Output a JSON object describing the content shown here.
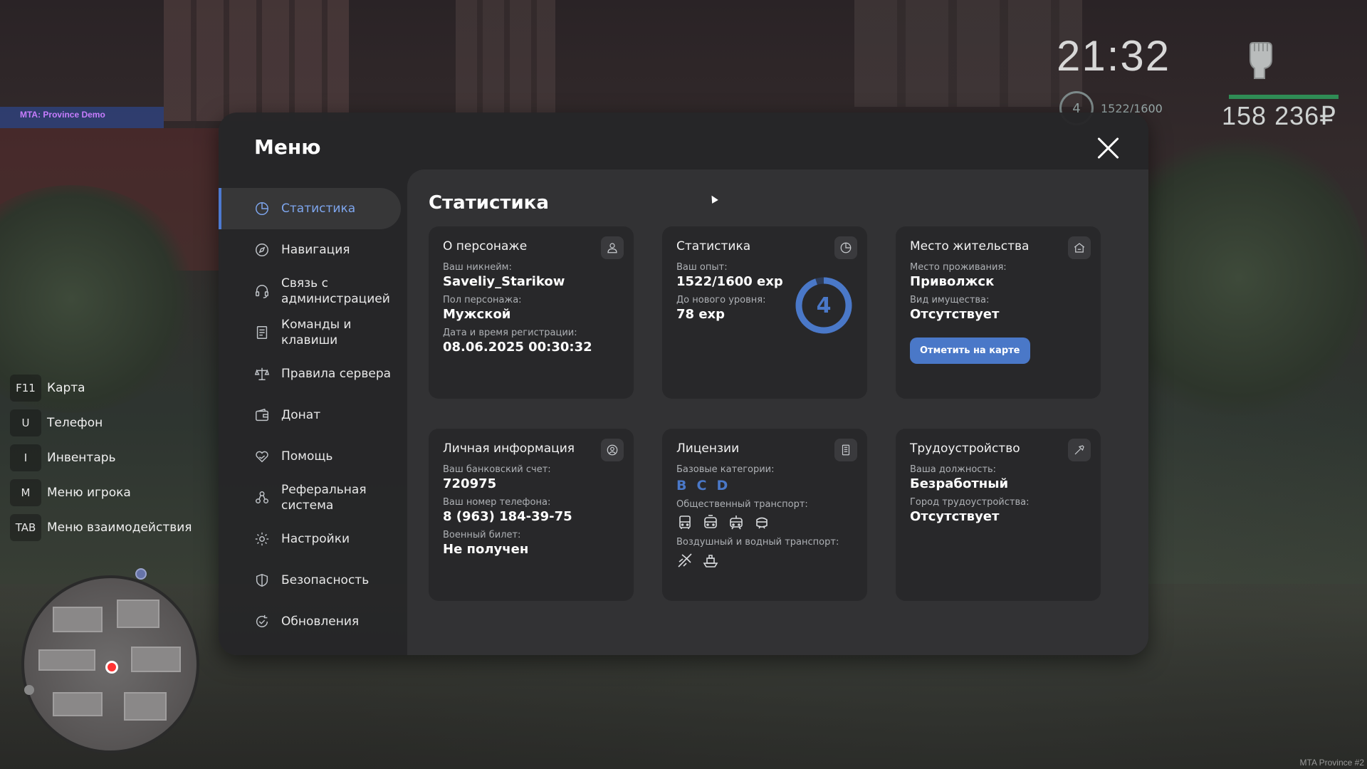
{
  "hud": {
    "server_label": "MTA: Province Demo",
    "clock": "21:32",
    "level": "4",
    "exp": "1522/1600",
    "money": "158 236₽",
    "watermark": "MTA Province #2",
    "health_color": "#2f8c55"
  },
  "hotkeys": [
    {
      "key": "F11",
      "label": "Карта"
    },
    {
      "key": "U",
      "label": "Телефон"
    },
    {
      "key": "I",
      "label": "Инвентарь"
    },
    {
      "key": "M",
      "label": "Меню игрока"
    },
    {
      "key": "TAB",
      "label": "Меню взаимодействия"
    }
  ],
  "menu": {
    "title": "Меню",
    "close_icon": "close-icon",
    "accent": "#4a78c8",
    "nav": [
      {
        "label": "Статистика",
        "icon": "pie-chart-icon",
        "active": true
      },
      {
        "label": "Навигация",
        "icon": "compass-icon"
      },
      {
        "label": "Связь с\nадминистрацией",
        "icon": "headset-icon"
      },
      {
        "label": "Команды и\nклавиши",
        "icon": "document-list-icon"
      },
      {
        "label": "Правила сервера",
        "icon": "scales-icon"
      },
      {
        "label": "Донат",
        "icon": "wallet-icon"
      },
      {
        "label": "Помощь",
        "icon": "heart-hand-icon"
      },
      {
        "label": "Реферальная\nсистема",
        "icon": "people-network-icon"
      },
      {
        "label": "Настройки",
        "icon": "gear-icon"
      },
      {
        "label": "Безопасность",
        "icon": "shield-icon"
      },
      {
        "label": "Обновления",
        "icon": "refresh-check-icon"
      }
    ]
  },
  "content": {
    "title": "Статистика",
    "character": {
      "title": "О персонаже",
      "nickname_label": "Ваш никнейм:",
      "nickname": "Saveliy_Starikow",
      "gender_label": "Пол персонажа:",
      "gender": "Мужской",
      "reg_label": "Дата и время регистрации:",
      "reg": "08.06.2025 00:30:32"
    },
    "stats": {
      "title": "Статистика",
      "exp_label": "Ваш опыт:",
      "exp": "1522/1600 exp",
      "next_label": "До нового уровня:",
      "next": "78 exp",
      "level": "4",
      "progress": 0.95
    },
    "residence": {
      "title": "Место жительства",
      "place_label": "Место проживания:",
      "place": "Приволжск",
      "property_label": "Вид имущества:",
      "property": "Отсутствует",
      "button": "Отметить на карте"
    },
    "personal": {
      "title": "Личная информация",
      "bank_label": "Ваш банковский счет:",
      "bank": "720975",
      "phone_label": "Ваш номер телефона:",
      "phone": "8 (963) 184-39-75",
      "military_label": "Военный билет:",
      "military": "Не получен"
    },
    "licenses": {
      "title": "Лицензии",
      "base_label": "Базовые категории:",
      "categories": [
        "B",
        "C",
        "D"
      ],
      "public_label": "Общественный транспорт:",
      "public_icons": [
        "bus-icon",
        "trolleybus-icon",
        "tram-icon",
        "train-icon"
      ],
      "air_label": "Воздушный и водный транспорт:",
      "air_icons": [
        "plane-icon",
        "boat-icon"
      ]
    },
    "job": {
      "title": "Трудоустройство",
      "position_label": "Ваша должность:",
      "position": "Безработный",
      "city_label": "Город трудоустройства:",
      "city": "Отсутствует"
    }
  }
}
